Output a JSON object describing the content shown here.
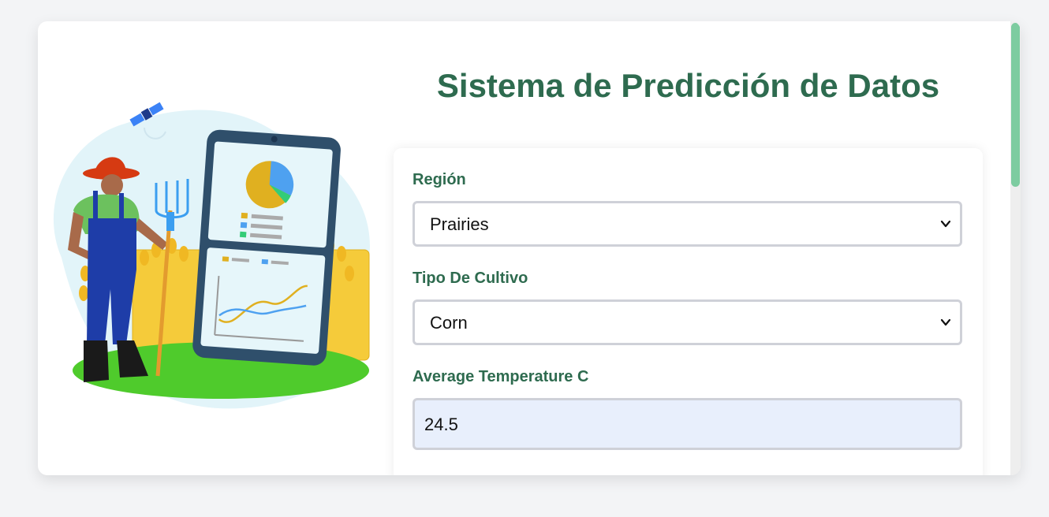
{
  "page": {
    "title": "Sistema de Predicción de Datos"
  },
  "form": {
    "region": {
      "label": "Región",
      "value": "Prairies"
    },
    "crop_type": {
      "label": "Tipo De Cultivo",
      "value": "Corn"
    },
    "avg_temperature": {
      "label": "Average Temperature C",
      "value": "24.5"
    }
  },
  "colors": {
    "accent": "#2e6b4f",
    "input_fill": "#e8effc",
    "scrollbar_thumb": "#7dcca0"
  },
  "icons": {
    "select_chevron": "chevron-down-icon"
  }
}
